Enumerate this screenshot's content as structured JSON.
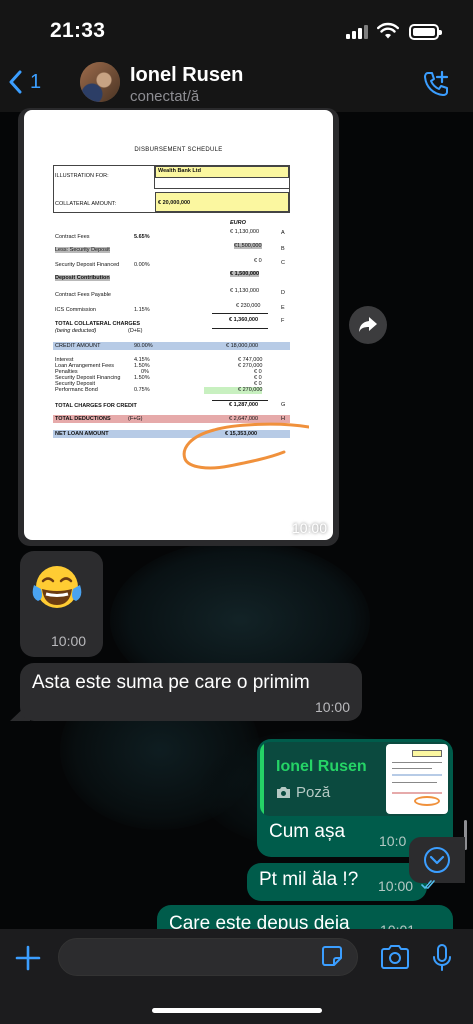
{
  "status_bar": {
    "time": "21:33"
  },
  "header": {
    "back_count": "1",
    "contact_name": "Ionel Rusen",
    "contact_status": "conectat/ă"
  },
  "messages": {
    "image": {
      "time": "10:00",
      "document": {
        "title": "DISBURSEMENT SCHEDULE",
        "illustration_for_label": "ILLUSTRATION FOR:",
        "illustration_for_value": "Wealth Bank Ltd",
        "collateral_amount_label": "COLLATERAL AMOUNT:",
        "collateral_amount_value": "€ 20,000,000",
        "currency": "EURO",
        "rows": [
          {
            "label": "Contract Fees",
            "rate": "5.65%",
            "amount": "€ 1,130,000",
            "ref": "A"
          },
          {
            "label": "Less: Security Deposit",
            "rate": "",
            "amount": "€1,500,000",
            "ref": "B"
          },
          {
            "label": "Security Deposit Financed",
            "rate": "0.00%",
            "amount": "€ 0",
            "ref": "C"
          },
          {
            "label": "Deposit Contribution",
            "rate": "",
            "amount": "€ 1,500,000",
            "ref": ""
          },
          {
            "label": "Contract Fees Payable",
            "rate": "",
            "amount": "€ 1,130,000",
            "ref": "D"
          },
          {
            "label": "ICS Commission",
            "rate": "1.15%",
            "amount": "€ 230,000",
            "ref": "E"
          },
          {
            "label": "TOTAL COLLATERAL CHARGES",
            "rate": "",
            "amount": "€ 1,360,000",
            "ref": "F"
          }
        ],
        "being_deducted": "(being deducted)",
        "being_deducted_formula": "(D+E)",
        "credit_amount": {
          "label": "CREDIT AMOUNT",
          "rate": "90.00%",
          "amount": "€ 18,000,000"
        },
        "credit_rows": [
          {
            "label": "Interest",
            "rate": "4.15%",
            "amount": "€ 747,000"
          },
          {
            "label": "Loan Arrangement Fees",
            "rate": "1.50%",
            "amount": "€ 270,000"
          },
          {
            "label": "Penalties",
            "rate": "0%",
            "amount": "€ 0"
          },
          {
            "label": "Security Deposit Financing",
            "rate": "1.50%",
            "amount": "€ 0"
          },
          {
            "label": "Security Deposit",
            "rate": "",
            "amount": "€ 0"
          },
          {
            "label": "Performanc Bond",
            "rate": "0.75%",
            "amount": "€ 270,000"
          }
        ],
        "total_charges": {
          "label": "TOTAL CHARGES FOR CREDIT",
          "amount": "€ 1,287,000",
          "ref": "G"
        },
        "total_deductions": {
          "label": "TOTAL DEDUCTIONS",
          "formula": "(F+G)",
          "amount": "€ 2,647,000",
          "ref": "H"
        },
        "net_loan": {
          "label": "NET LOAN AMOUNT",
          "amount": "€ 15,353,000"
        }
      }
    },
    "emoji": {
      "time": "10:00"
    },
    "incoming_text": {
      "text": "Asta este suma pe care o primim",
      "time": "10:00"
    },
    "reply": {
      "quoted_name": "Ionel Rusen",
      "quoted_type": "Poză",
      "text": "Cum așa",
      "time": "10:0"
    },
    "outgoing_2": {
      "text": "Pt mil ăla !?",
      "time": "10:00"
    },
    "outgoing_3": {
      "text": "Care este depus deja",
      "time": "10:01"
    }
  },
  "colors": {
    "accent": "#3b9eff",
    "outgoing_bubble": "#005c4b",
    "incoming_bubble": "#2c2c2e",
    "quote_name": "#25d366"
  },
  "icons": [
    "back-chevron-icon",
    "add-call-icon",
    "forward-icon",
    "scroll-down-icon",
    "plus-icon",
    "sticker-icon",
    "camera-icon",
    "mic-icon"
  ]
}
